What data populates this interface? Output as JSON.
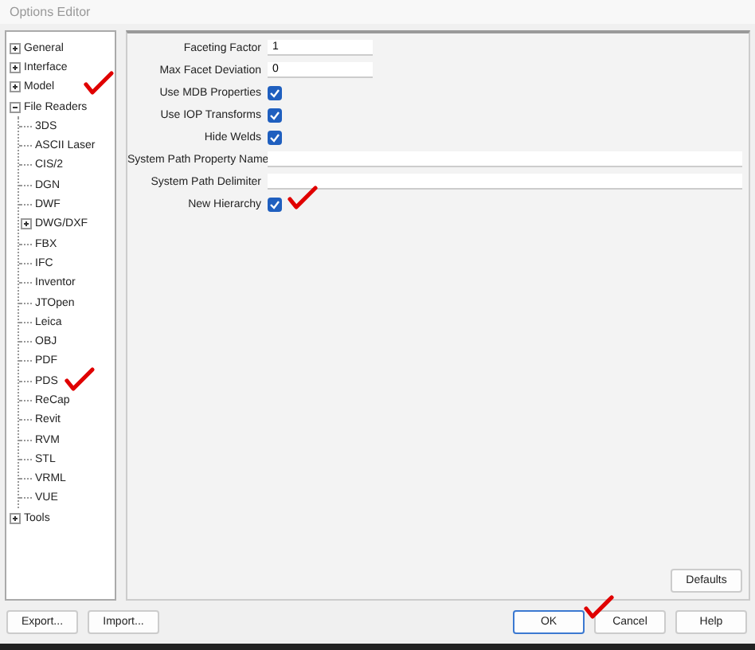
{
  "window": {
    "title": "Options Editor"
  },
  "tree": [
    {
      "label": "General",
      "expanded": false
    },
    {
      "label": "Interface",
      "expanded": false
    },
    {
      "label": "Model",
      "expanded": false
    },
    {
      "label": "File Readers",
      "expanded": true,
      "children": [
        {
          "label": "3DS"
        },
        {
          "label": "ASCII Laser"
        },
        {
          "label": "CIS/2"
        },
        {
          "label": "DGN"
        },
        {
          "label": "DWF"
        },
        {
          "label": "DWG/DXF",
          "expanded": false
        },
        {
          "label": "FBX"
        },
        {
          "label": "IFC"
        },
        {
          "label": "Inventor"
        },
        {
          "label": "JTOpen"
        },
        {
          "label": "Leica"
        },
        {
          "label": "OBJ"
        },
        {
          "label": "PDF"
        },
        {
          "label": "PDS"
        },
        {
          "label": "ReCap"
        },
        {
          "label": "Revit"
        },
        {
          "label": "RVM"
        },
        {
          "label": "STL"
        },
        {
          "label": "VRML"
        },
        {
          "label": "VUE"
        }
      ]
    },
    {
      "label": "Tools",
      "expanded": false
    }
  ],
  "options": [
    {
      "kind": "short_field",
      "label": "Faceting Factor",
      "value": "1"
    },
    {
      "kind": "short_field",
      "label": "Max Facet Deviation",
      "value": "0"
    },
    {
      "kind": "checkbox",
      "label": "Use MDB Properties",
      "checked": true
    },
    {
      "kind": "checkbox",
      "label": "Use IOP Transforms",
      "checked": true
    },
    {
      "kind": "checkbox",
      "label": "Hide Welds",
      "checked": true
    },
    {
      "kind": "long_field",
      "label": "System Path Property Name"
    },
    {
      "kind": "long_field",
      "label": "System Path Delimiter"
    },
    {
      "kind": "checkbox",
      "label": "New Hierarchy",
      "checked": true
    }
  ],
  "defaults_button": "Defaults",
  "left_buttons": [
    "Export...",
    "Import..."
  ],
  "right_buttons": [
    {
      "label": "OK",
      "default": true
    },
    {
      "label": "Cancel",
      "default": false
    },
    {
      "label": "Help",
      "default": false
    }
  ]
}
